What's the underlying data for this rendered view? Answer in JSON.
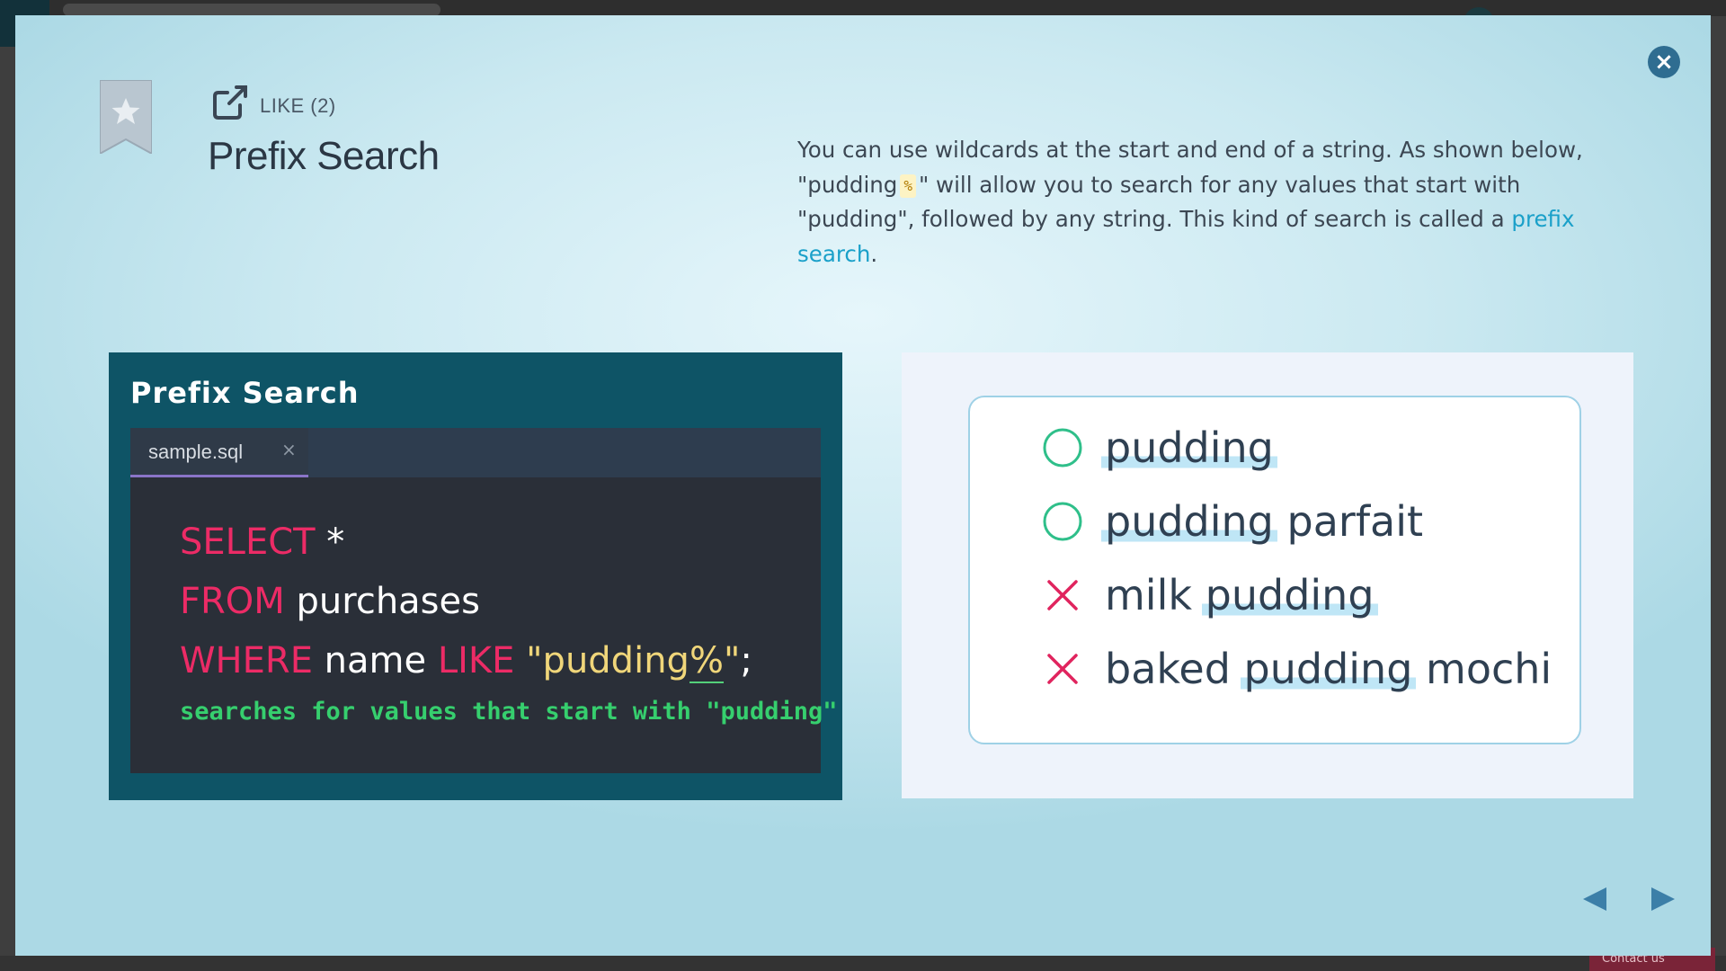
{
  "background": {
    "contact_label": "Contact us"
  },
  "modal": {
    "close_label": "×",
    "lesson_label": "LIKE (2)",
    "title": "Prefix Search",
    "description": {
      "part1": "You can use wildcards at the start and end of a string. As shown below, \"pudding",
      "wildcard": "%",
      "part2": "\" will allow you to search for any values that start with \"pudding\", followed by any string. This kind of search is called a ",
      "link": "prefix search",
      "part3": "."
    },
    "icons": {
      "bookmark": "bookmark-star-icon",
      "header": "external-link-icon"
    }
  },
  "code_panel": {
    "title": "Prefix Search",
    "tab_label": "sample.sql",
    "tab_close": "×",
    "line1": {
      "kw": "SELECT",
      "rest": " *"
    },
    "line2": {
      "kw": "FROM",
      "rest": " purchases"
    },
    "line3": {
      "kw1": "WHERE",
      "mid": " name ",
      "kw2": "LIKE",
      "str_a": " \"pudding",
      "pct": "%",
      "str_b": "\"",
      "tail": ";"
    },
    "comment": "searches for values that start with \"pudding\""
  },
  "results": {
    "rows": [
      {
        "match": true,
        "before": "",
        "highlight": "pudding",
        "after": ""
      },
      {
        "match": true,
        "before": "",
        "highlight": "pudding",
        "after": " parfait"
      },
      {
        "match": false,
        "before": "milk ",
        "highlight": "pudding",
        "after": ""
      },
      {
        "match": false,
        "before": "baked ",
        "highlight": "pudding",
        "after": " mochi"
      }
    ]
  },
  "colors": {
    "accent": "#2f6d91",
    "keyword": "#ec2b66",
    "string": "#f0d67a",
    "comment": "#36cf6e",
    "match": "#2fbf8a",
    "no_match": "#e0245e",
    "link": "#1aa0c9"
  }
}
